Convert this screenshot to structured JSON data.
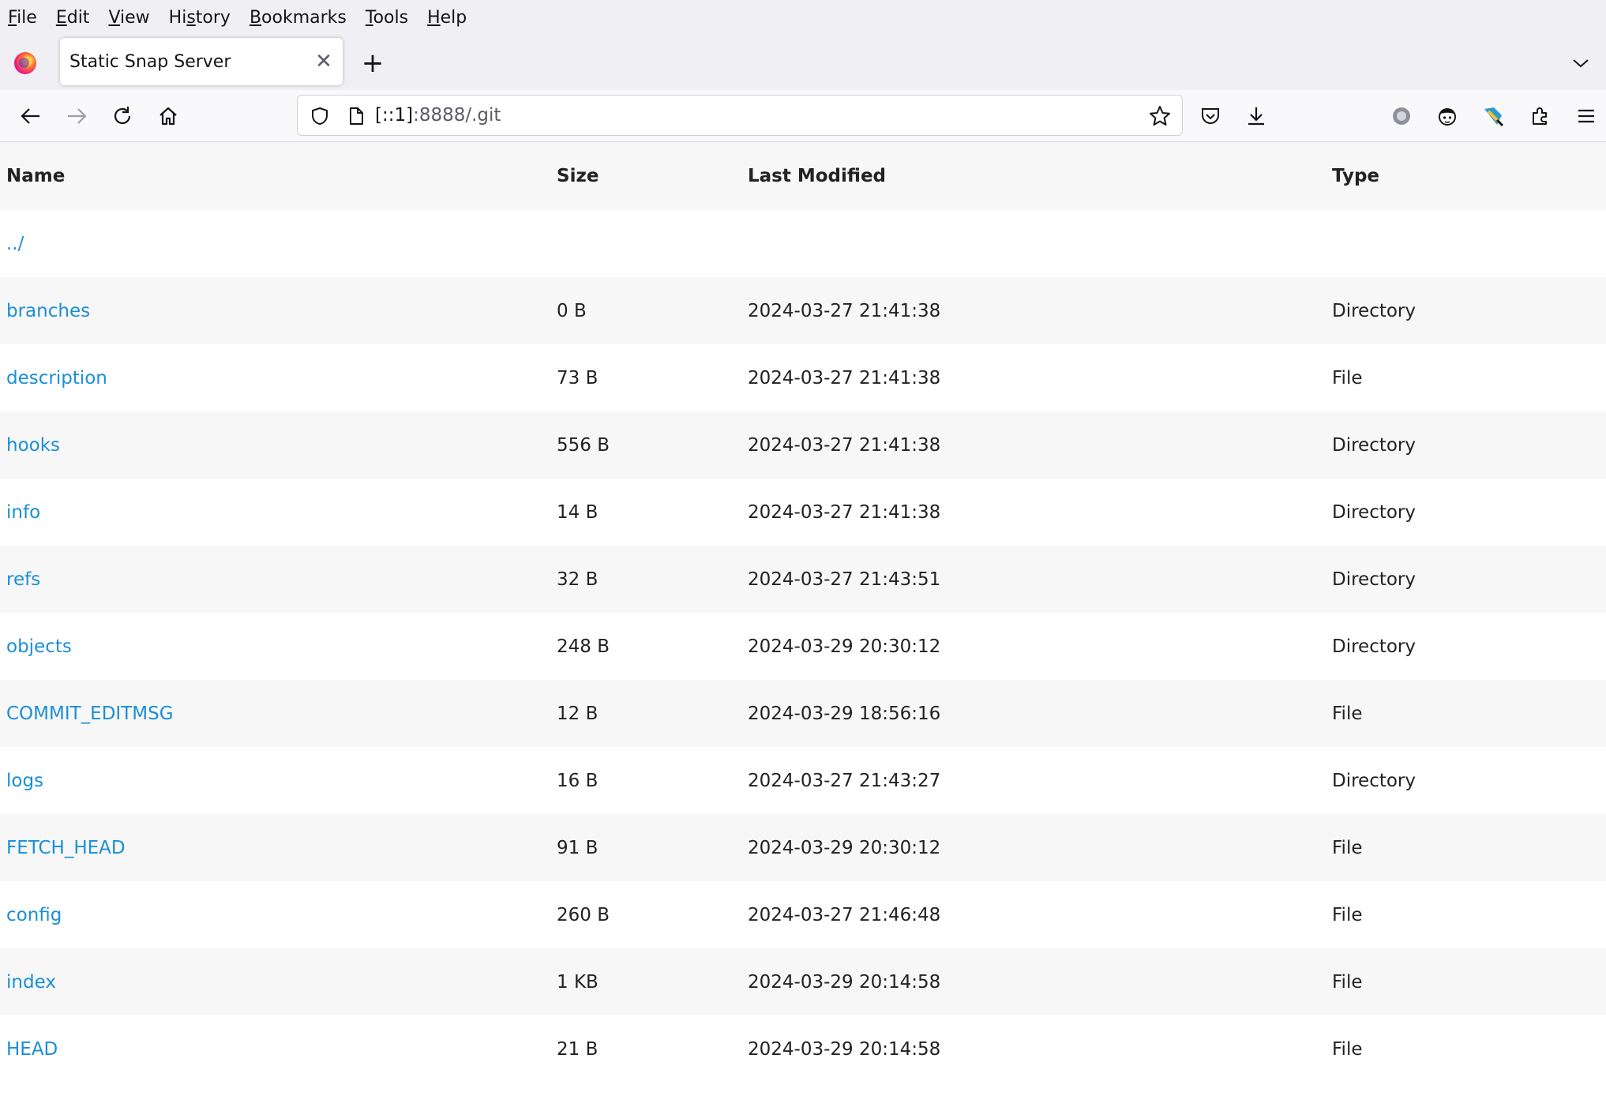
{
  "menu": [
    "File",
    "Edit",
    "View",
    "History",
    "Bookmarks",
    "Tools",
    "Help"
  ],
  "menu_access_keys": [
    "F",
    "E",
    "V",
    "s",
    "B",
    "T",
    "H"
  ],
  "tab": {
    "title": "Static Snap Server",
    "close": "✕",
    "new": "+"
  },
  "urlbar": {
    "host": "[::1]",
    "rest": ":8888/.git"
  },
  "table": {
    "headers": {
      "name": "Name",
      "size": "Size",
      "modified": "Last Modified",
      "type": "Type"
    },
    "rows": [
      {
        "name": "../",
        "size": "",
        "modified": "",
        "type": ""
      },
      {
        "name": "branches",
        "size": "0 B",
        "modified": "2024-03-27 21:41:38",
        "type": "Directory"
      },
      {
        "name": "description",
        "size": "73 B",
        "modified": "2024-03-27 21:41:38",
        "type": "File"
      },
      {
        "name": "hooks",
        "size": "556 B",
        "modified": "2024-03-27 21:41:38",
        "type": "Directory"
      },
      {
        "name": "info",
        "size": "14 B",
        "modified": "2024-03-27 21:41:38",
        "type": "Directory"
      },
      {
        "name": "refs",
        "size": "32 B",
        "modified": "2024-03-27 21:43:51",
        "type": "Directory"
      },
      {
        "name": "objects",
        "size": "248 B",
        "modified": "2024-03-29 20:30:12",
        "type": "Directory"
      },
      {
        "name": "COMMIT_EDITMSG",
        "size": "12 B",
        "modified": "2024-03-29 18:56:16",
        "type": "File"
      },
      {
        "name": "logs",
        "size": "16 B",
        "modified": "2024-03-27 21:43:27",
        "type": "Directory"
      },
      {
        "name": "FETCH_HEAD",
        "size": "91 B",
        "modified": "2024-03-29 20:30:12",
        "type": "File"
      },
      {
        "name": "config",
        "size": "260 B",
        "modified": "2024-03-27 21:46:48",
        "type": "File"
      },
      {
        "name": "index",
        "size": "1 KB",
        "modified": "2024-03-29 20:14:58",
        "type": "File"
      },
      {
        "name": "HEAD",
        "size": "21 B",
        "modified": "2024-03-29 20:14:58",
        "type": "File"
      }
    ]
  },
  "colors": {
    "link": "#1a8fd6",
    "row_alt": "#f7f7f7",
    "chrome": "#f0f0f4"
  }
}
